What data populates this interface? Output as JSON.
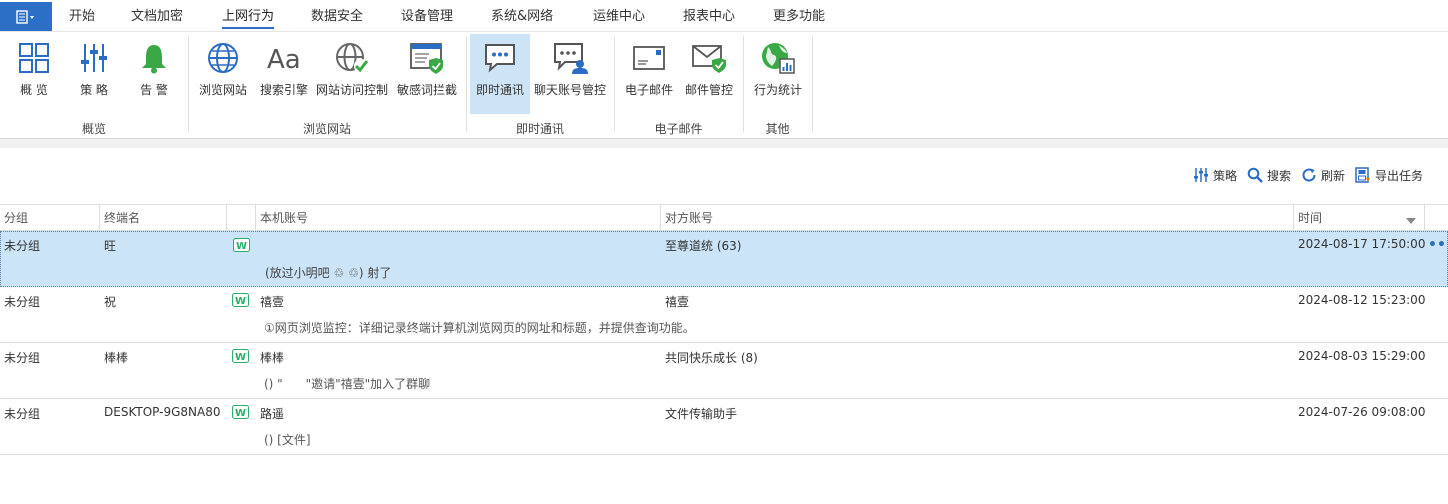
{
  "menu": {
    "items": [
      "开始",
      "文档加密",
      "上网行为",
      "数据安全",
      "设备管理",
      "系统&网络",
      "运维中心",
      "报表中心",
      "更多功能"
    ],
    "active_index": 2
  },
  "ribbon": {
    "buttons": [
      "概 览",
      "策 略",
      "告 警",
      "浏览网站",
      "搜索引擎",
      "网站访问控制",
      "敏感词拦截",
      "即时通讯",
      "聊天账号管控",
      "电子邮件",
      "邮件管控",
      "行为统计"
    ],
    "selected_button": "即时通讯",
    "groups": [
      "概览",
      "浏览网站",
      "即时通讯",
      "电子邮件",
      "其他"
    ]
  },
  "toolbar": {
    "policy": "策略",
    "search": "搜索",
    "refresh": "刷新",
    "export": "导出任务"
  },
  "table": {
    "columns": [
      "分组",
      "终端名",
      "本机账号",
      "对方账号",
      "时间"
    ],
    "rows": [
      {
        "group": "未分组",
        "terminal": "旺",
        "local_account": "",
        "peer_account": "至尊道统 (63)",
        "time": "2024-08-17 17:50:00",
        "message": "(放过小明吧 ♲ ♲) 射了",
        "selected": true
      },
      {
        "group": "未分组",
        "terminal": "祝",
        "local_account": "禧壹",
        "peer_account": "禧壹",
        "time": "2024-08-12 15:23:00",
        "message": "①网页浏览监控：详细记录终端计算机浏览网页的网址和标题，并提供查询功能。",
        "selected": false
      },
      {
        "group": "未分组",
        "terminal": "棒棒",
        "local_account": "棒棒",
        "peer_account": "共同快乐成长 (8)",
        "time": "2024-08-03 15:29:00",
        "message": "() \"      \"邀请\"禧壹\"加入了群聊",
        "selected": false
      },
      {
        "group": "未分组",
        "terminal": "DESKTOP-9G8NA80",
        "local_account": "路遥",
        "peer_account": "文件传输助手",
        "time": "2024-07-26 09:08:00",
        "message": "() [文件]",
        "selected": false
      }
    ]
  },
  "colors": {
    "accent": "#2b6cc4",
    "selected_row": "#cce4f7",
    "wechat": "#2aae67"
  }
}
